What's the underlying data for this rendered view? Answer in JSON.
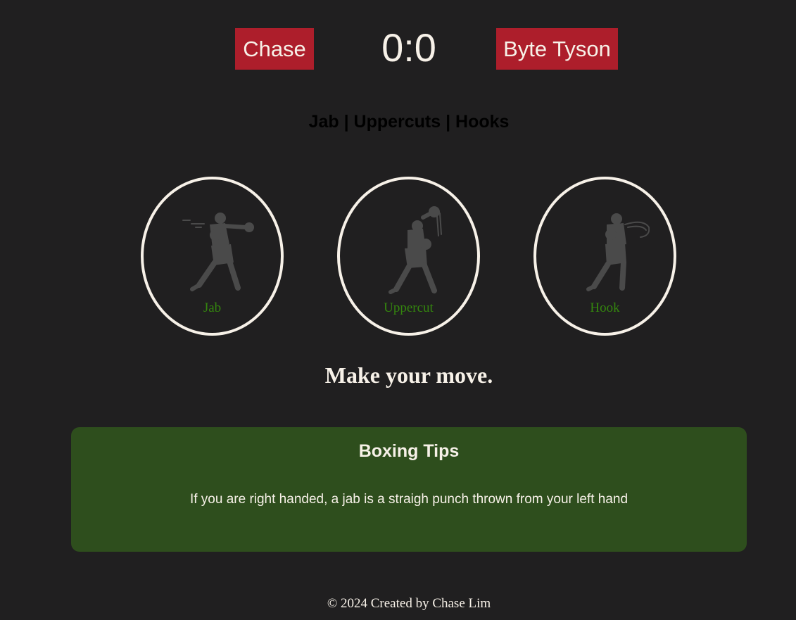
{
  "colors": {
    "background": "#201f20",
    "badge": "#ad1e2b",
    "cream": "#f7f1e8",
    "move_label": "#34860e",
    "tips_card": "#2e4e1d",
    "figure": "#4a4a4a"
  },
  "scoreboard": {
    "player_name": "Chase",
    "computer_name": "Byte Tyson",
    "score": "0:0"
  },
  "moves_header": "Jab | Uppercuts | Hooks",
  "moves": [
    {
      "label": "Jab",
      "icon": "boxer-jab-icon"
    },
    {
      "label": "Uppercut",
      "icon": "boxer-uppercut-icon"
    },
    {
      "label": "Hook",
      "icon": "boxer-hook-icon"
    }
  ],
  "status_message": "Make your move.",
  "tips": {
    "title": "Boxing Tips",
    "text": "If you are right handed, a jab is a straigh punch thrown from your left hand"
  },
  "footer": "© 2024 Created by Chase Lim"
}
